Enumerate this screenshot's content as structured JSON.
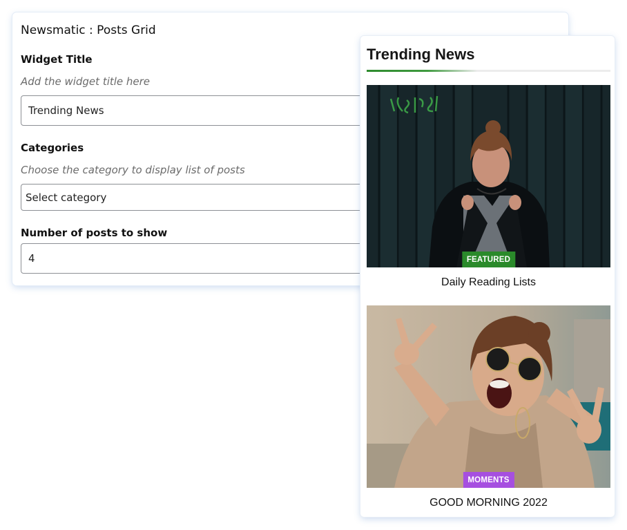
{
  "settings": {
    "panel_title": "Newsmatic : Posts Grid",
    "widget_title": {
      "label": "Widget Title",
      "help": "Add the widget title here",
      "value": "Trending News"
    },
    "categories": {
      "label": "Categories",
      "help": "Choose the category to display list of posts",
      "selected": "Select category"
    },
    "number_of_posts": {
      "label": "Number of posts to show",
      "value": "4"
    }
  },
  "preview": {
    "heading": "Trending News",
    "accent_color": "#3a963a",
    "posts": [
      {
        "badge": "FEATURED",
        "badge_color": "#2a8a2a",
        "title": "Daily Reading Lists",
        "image": "woman-leaning-on-dark-wood-fence-photo"
      },
      {
        "badge": "MOMENTS",
        "badge_color": "#a64fe0",
        "title": "GOOD MORNING 2022",
        "image": "woman-in-sunglasses-peace-signs-photo"
      }
    ]
  }
}
